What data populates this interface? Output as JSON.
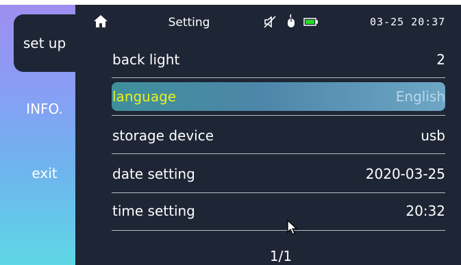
{
  "sidebar": {
    "items": [
      {
        "label": "set up",
        "active": true
      },
      {
        "label": "INFO.",
        "active": false
      },
      {
        "label": "exit",
        "active": false
      }
    ]
  },
  "statusbar": {
    "title": "Setting",
    "clock": "03-25 20:37",
    "icons": [
      "home-icon",
      "mute-icon",
      "mouse-icon",
      "battery-icon"
    ]
  },
  "settings": [
    {
      "label": "back light",
      "value": "2",
      "selected": false
    },
    {
      "label": "language",
      "value": "English",
      "selected": true
    },
    {
      "label": "storage device",
      "value": "usb",
      "selected": false
    },
    {
      "label": "date setting",
      "value": "2020-03-25",
      "selected": false
    },
    {
      "label": "time setting",
      "value": "20:32",
      "selected": false
    }
  ],
  "pager": "1/1",
  "colors": {
    "panel": "#1e2535",
    "selected_label": "#e8f21c",
    "battery": "#22dd22"
  }
}
